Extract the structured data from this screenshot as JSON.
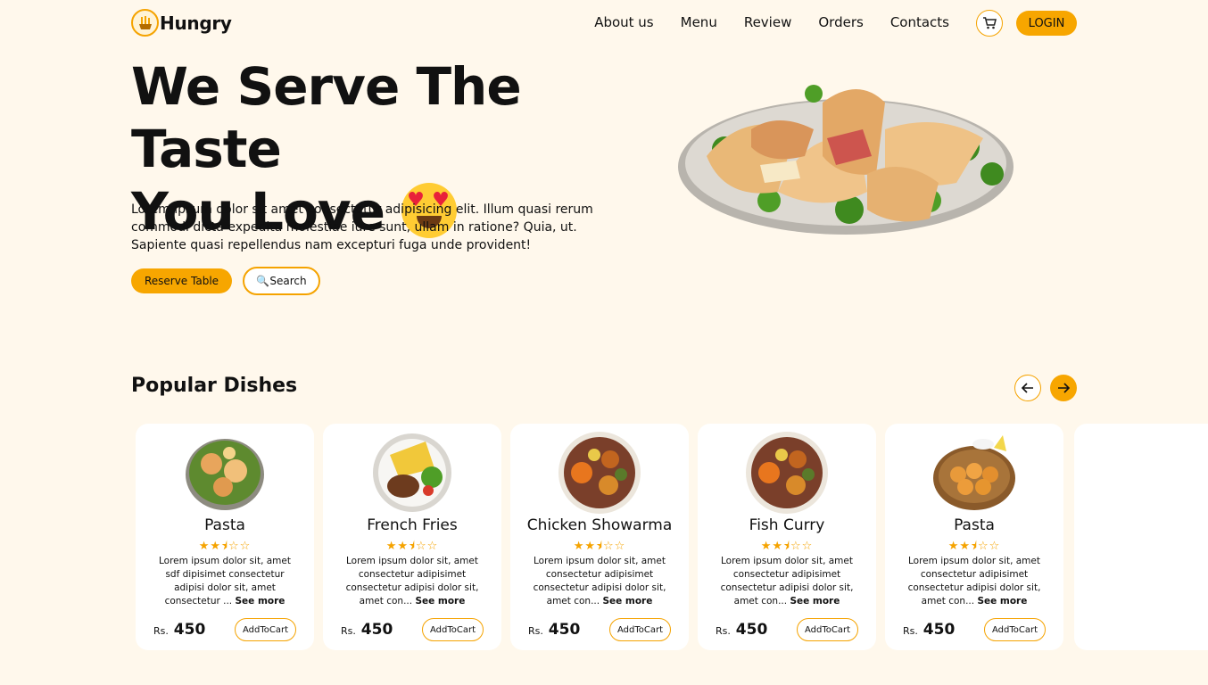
{
  "brand": {
    "name": "Hungry",
    "icon": "logo-food-icon"
  },
  "nav": {
    "links": [
      "About us",
      "Menu",
      "Review",
      "Orders",
      "Contacts"
    ],
    "cart_icon": "cart-icon",
    "login_label": "LOGIN"
  },
  "hero": {
    "title_line1": "We Serve The Taste",
    "title_line2": "You Love",
    "emoji": "heart-eyes-emoji",
    "description": "Lorem ipsum dolor sit amet consectetur adipisicing elit. Illum quasi rerum commodi dicta expedita molestiae iure sunt, ullam in ratione? Quia, ut. Sapiente quasi repellendus nam excepturi fuga unde provident!",
    "reserve_label": "Reserve Table",
    "search_label": "🔍Search",
    "image": "sandwich-platter-image"
  },
  "popular": {
    "title": "Popular Dishes",
    "prev_icon": "arrow-left-icon",
    "next_icon": "arrow-right-icon",
    "dishes": [
      {
        "name": "Pasta",
        "rating": 2.5,
        "desc": "Lorem ipsum dolor sit, amet sdf dipisimet consectetur adipisi dolor sit, amet consectetur ...",
        "see_more": "See more",
        "currency": "Rs.",
        "price": "450",
        "add_label": "AddToCart",
        "image": "pasta-dish-image"
      },
      {
        "name": "French Fries",
        "rating": 2.5,
        "desc": "Lorem ipsum dolor sit, amet consectetur adipisimet consectetur adipisi dolor sit, amet con...",
        "see_more": "See more",
        "currency": "Rs.",
        "price": "450",
        "add_label": "AddToCart",
        "image": "steak-fries-image"
      },
      {
        "name": "Chicken Showarma",
        "rating": 2.5,
        "desc": "Lorem ipsum dolor sit, amet consectetur adipisimet consectetur adipisi dolor sit, amet con...",
        "see_more": "See more",
        "currency": "Rs.",
        "price": "450",
        "add_label": "AddToCart",
        "image": "platter-dish-image"
      },
      {
        "name": "Fish Curry",
        "rating": 2.5,
        "desc": "Lorem ipsum dolor sit, amet consectetur adipisimet consectetur adipisi dolor sit, amet con...",
        "see_more": "See more",
        "currency": "Rs.",
        "price": "450",
        "add_label": "AddToCart",
        "image": "platter-dish-image"
      },
      {
        "name": "Pasta",
        "rating": 2.5,
        "desc": "Lorem ipsum dolor sit, amet consectetur adipisimet consectetur adipisi dolor sit, amet con...",
        "see_more": "See more",
        "currency": "Rs.",
        "price": "450",
        "add_label": "AddToCart",
        "image": "fried-bites-image"
      }
    ]
  },
  "colors": {
    "accent": "#f7a600",
    "background": "#fff8ec",
    "card": "#ffffff"
  }
}
